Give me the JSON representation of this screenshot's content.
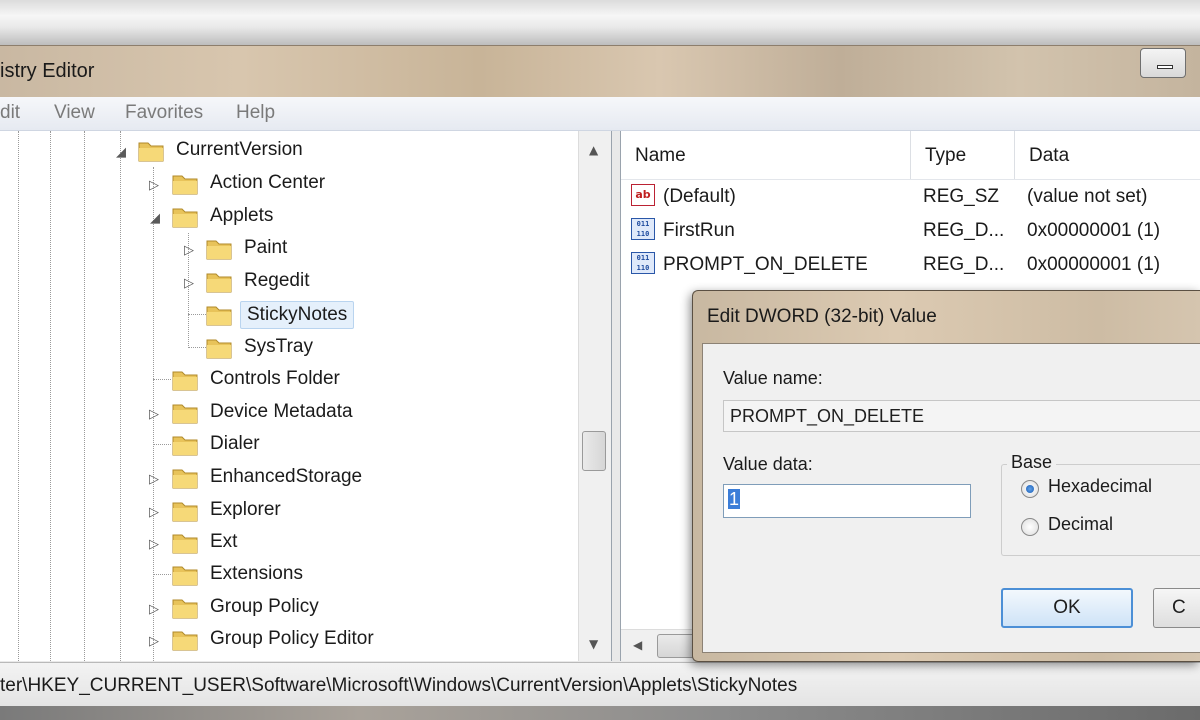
{
  "window": {
    "title": "istry Editor"
  },
  "menu": [
    "Edit",
    "View",
    "Favorites",
    "Help"
  ],
  "menu_display": [
    "dit",
    "View",
    "Favorites",
    "Help"
  ],
  "tree": {
    "nodes": [
      {
        "label": "CurrentVersion",
        "expanded": true
      },
      {
        "label": "Action Center",
        "expanded": false
      },
      {
        "label": "Applets",
        "expanded": true
      },
      {
        "label": "Paint",
        "expanded": false
      },
      {
        "label": "Regedit",
        "expanded": false
      },
      {
        "label": "StickyNotes",
        "selected": true
      },
      {
        "label": "SysTray"
      },
      {
        "label": "Controls Folder"
      },
      {
        "label": "Device Metadata",
        "expanded": false
      },
      {
        "label": "Dialer"
      },
      {
        "label": "EnhancedStorage",
        "expanded": false
      },
      {
        "label": "Explorer",
        "expanded": false
      },
      {
        "label": "Ext",
        "expanded": false
      },
      {
        "label": "Extensions"
      },
      {
        "label": "Group Policy",
        "expanded": false
      },
      {
        "label": "Group Policy Editor",
        "expanded": false
      }
    ]
  },
  "list": {
    "columns": [
      "Name",
      "Type",
      "Data"
    ],
    "rows": [
      {
        "icon": "string-value-icon",
        "name": "(Default)",
        "type": "REG_SZ",
        "data": "(value not set)"
      },
      {
        "icon": "dword-value-icon",
        "name": "FirstRun",
        "type": "REG_D...",
        "data": "0x00000001 (1)"
      },
      {
        "icon": "dword-value-icon",
        "name": "PROMPT_ON_DELETE",
        "type": "REG_D...",
        "data": "0x00000001 (1)"
      }
    ]
  },
  "statusbar": {
    "path": "ter\\HKEY_CURRENT_USER\\Software\\Microsoft\\Windows\\CurrentVersion\\Applets\\StickyNotes"
  },
  "dialog": {
    "title": "Edit DWORD (32-bit) Value",
    "value_name_label": "Value name:",
    "value_name": "PROMPT_ON_DELETE",
    "value_data_label": "Value data:",
    "value_data": "1",
    "base_label": "Base",
    "base_options": [
      {
        "label": "Hexadecimal",
        "selected": true
      },
      {
        "label": "Decimal",
        "selected": false
      }
    ],
    "ok_label": "OK",
    "cancel_label": "C"
  }
}
